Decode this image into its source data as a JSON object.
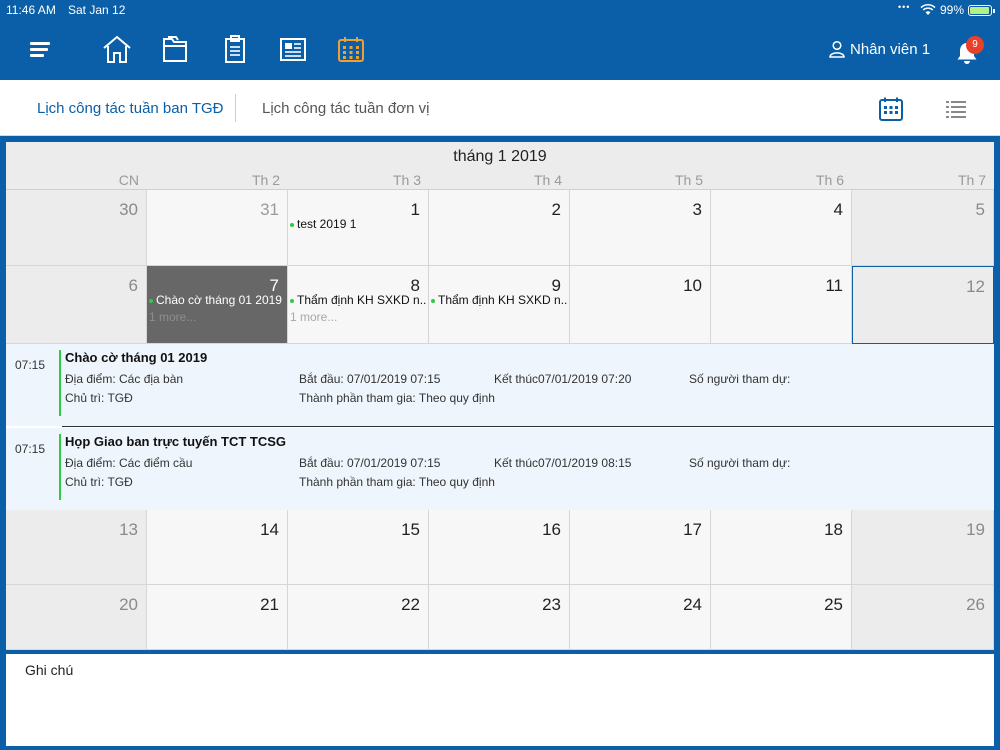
{
  "status_bar": {
    "time": "11:46 AM",
    "date": "Sat Jan 12",
    "battery": "99%"
  },
  "nav": {
    "icons": [
      "menu-icon",
      "home-icon",
      "folders-icon",
      "clipboard-icon",
      "newspaper-icon",
      "calendar-icon"
    ],
    "active_icon": "calendar-icon",
    "user_name": "Nhân viên 1",
    "notification_count": "9"
  },
  "tabs": {
    "active": "Lịch công tác tuần ban TGĐ",
    "inactive": "Lịch công tác tuần đơn vị"
  },
  "calendar": {
    "month_title": "tháng 1 2019",
    "weekdays": [
      "CN",
      "Th 2",
      "Th 3",
      "Th 4",
      "Th 5",
      "Th 6",
      "Th 7"
    ],
    "weeks": [
      {
        "days": [
          {
            "num": "30",
            "other": true
          },
          {
            "num": "31",
            "other": true
          },
          {
            "num": "1",
            "events": [
              "test 2019 1"
            ]
          },
          {
            "num": "2"
          },
          {
            "num": "3"
          },
          {
            "num": "4"
          },
          {
            "num": "5"
          }
        ]
      },
      {
        "days": [
          {
            "num": "6"
          },
          {
            "num": "7",
            "selected": true,
            "events": [
              "Chào cờ tháng 01 2019"
            ],
            "more": "1 more..."
          },
          {
            "num": "8",
            "events": [
              "Thẩm định KH SXKD n..."
            ],
            "more": "1 more..."
          },
          {
            "num": "9",
            "events": [
              "Thẩm định KH SXKD n..."
            ]
          },
          {
            "num": "10"
          },
          {
            "num": "11"
          },
          {
            "num": "12",
            "today": true
          }
        ]
      },
      {
        "days": [
          {
            "num": "13"
          },
          {
            "num": "14"
          },
          {
            "num": "15"
          },
          {
            "num": "16"
          },
          {
            "num": "17"
          },
          {
            "num": "18"
          },
          {
            "num": "19"
          }
        ]
      },
      {
        "days": [
          {
            "num": "20"
          },
          {
            "num": "21"
          },
          {
            "num": "22"
          },
          {
            "num": "23"
          },
          {
            "num": "24"
          },
          {
            "num": "25"
          },
          {
            "num": "26"
          }
        ]
      }
    ]
  },
  "agenda": [
    {
      "time": "07:15",
      "title": "Chào cờ tháng 01 2019",
      "location": "Địa điểm: Các địa bàn",
      "start": "Bắt đầu: 07/01/2019 07:15",
      "end": "Kết thúc07/01/2019 07:20",
      "attendees": "Số người tham dự:",
      "host": "Chủ trì: TGĐ",
      "participants": "Thành phần tham gia: Theo quy định"
    },
    {
      "time": "07:15",
      "title": "Họp Giao ban trực tuyến TCT TCSG",
      "location": "Địa điểm: Các điểm cầu",
      "start": "Bắt đầu: 07/01/2019 07:15",
      "end": "Kết thúc07/01/2019 08:15",
      "attendees": "Số người tham dự:",
      "host": "Chủ trì: TGĐ",
      "participants": "Thành phần tham gia: Theo quy định"
    }
  ],
  "notes": {
    "label": "Ghi chú"
  },
  "colors": {
    "brand": "#0a5fa8",
    "accent_orange": "#f0a030",
    "event_dot": "#2ecc40",
    "badge": "#e8402a"
  }
}
